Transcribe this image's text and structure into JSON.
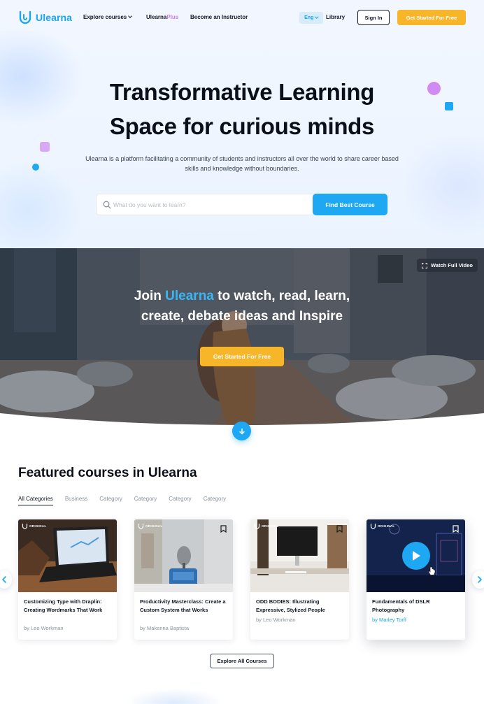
{
  "brand": {
    "name": "Ulearna",
    "accent": "#1ea7f2",
    "cta": "#f7b52a",
    "plus_color": "#c77df2"
  },
  "nav": {
    "explore": "Explore courses",
    "plus_prefix": "Ulearna",
    "plus_suffix": "Plus",
    "instructor": "Become an Instructor",
    "lang": "Eng",
    "library": "Library",
    "signin": "Sign In",
    "get_started": "Get Started For Free"
  },
  "hero": {
    "title_line1": "Transformative Learning",
    "title_line2": "Space for curious minds",
    "subtitle": "Ulearna is a platform facilitating a community of students and instructors all over the world to share career based skills and knowledge without boundaries.",
    "search_placeholder": "What do you want to learn?",
    "search_button": "Find Best Course"
  },
  "banner": {
    "watch_label": "Watch Full Video",
    "title_pre": "Join ",
    "title_brand": "Ulearna",
    "title_post": " to watch, read, learn,",
    "title_line2": "create, debate ideas and Inspire",
    "cta": "Get Started For Free"
  },
  "featured": {
    "title": "Featured courses in Ulearna",
    "tabs": [
      "All Categories",
      "Business",
      "Category",
      "Category",
      "Category",
      "Category"
    ],
    "badge": "ORIGINAL",
    "courses": [
      {
        "title": "Customizing Type with Draplin: Creating Wordmarks That Work",
        "author": "by Leo Workman"
      },
      {
        "title": "Productivity Masterclass: Create a Custom System that Works",
        "author": "by Makenna Baptista"
      },
      {
        "title": "ODD BODIES: Illustrating Expressive, Stylized People",
        "author": "by Leo Workman"
      },
      {
        "title": "Fundamentals of DSLR Photography",
        "author": "by Marley Torff"
      }
    ],
    "explore_button": "Explore All Courses"
  }
}
